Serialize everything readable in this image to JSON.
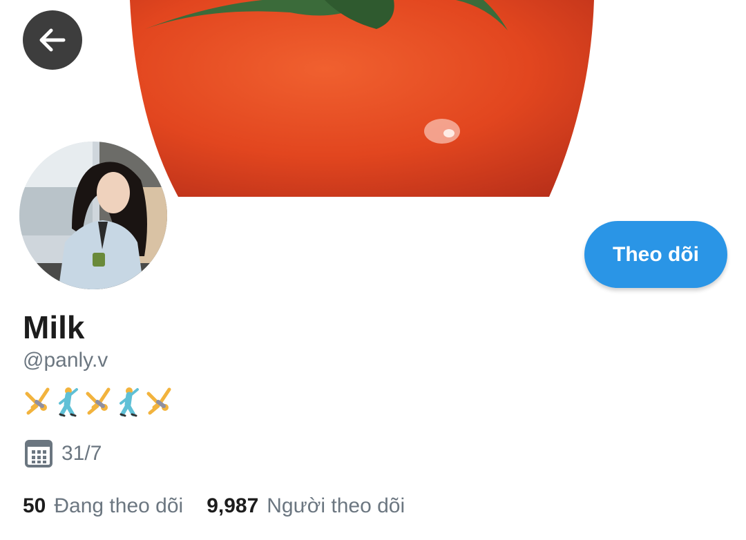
{
  "profile": {
    "display_name": "Milk",
    "handle": "@panly.v",
    "bio_emoji": [
      "person-cartwheeling",
      "man-dancing",
      "person-cartwheeling",
      "man-dancing",
      "person-cartwheeling"
    ],
    "joined": "31/7"
  },
  "actions": {
    "follow_label": "Theo dõi",
    "back_icon": "arrow-left-icon"
  },
  "stats": {
    "following_count": "50",
    "following_label": "Đang theo dõi",
    "followers_count": "9,987",
    "followers_label": "Người theo dõi"
  },
  "colors": {
    "accent": "#2a95e6",
    "text_primary": "#1c1c1c",
    "text_secondary": "#6b7680",
    "back_button": "#3d3d3d",
    "banner_tomato": "#e2461f"
  }
}
